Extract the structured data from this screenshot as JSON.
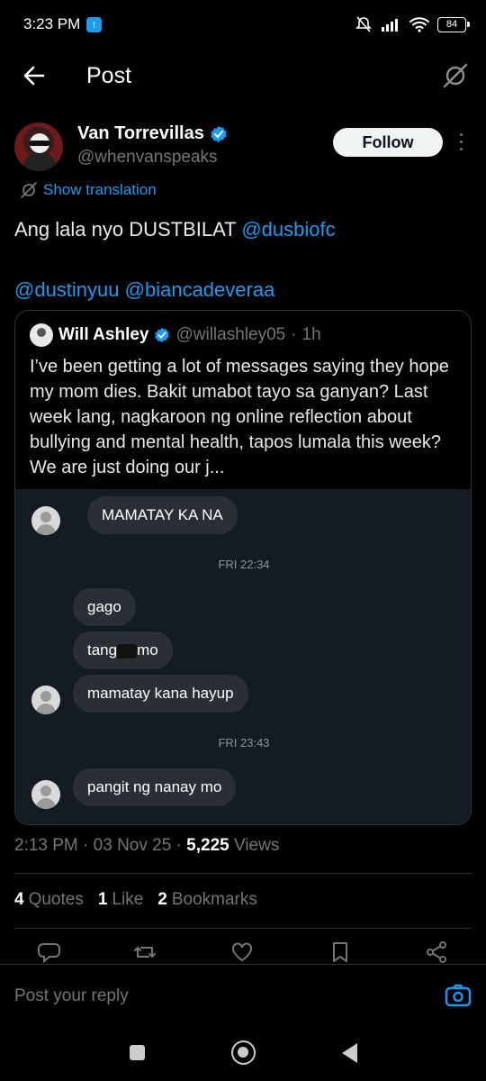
{
  "status_bar": {
    "time": "3:23 PM",
    "battery": "84"
  },
  "nav": {
    "title": "Post"
  },
  "author": {
    "name": "Van Torrevillas",
    "handle": "@whenvanspeaks",
    "follow_label": "Follow"
  },
  "translate_label": "Show translation",
  "tweet": {
    "text": "Ang lala nyo DUSTBILAT",
    "mention1": "@dusbiofc",
    "mention2": "@dustinyuu",
    "mention3": "@biancadeveraa"
  },
  "quote": {
    "name": "Will Ashley",
    "handle": "@willashley05",
    "time": "1h",
    "text": "I’ve been getting a lot of messages saying they hope my mom dies. Bakit umabot tayo sa ganyan? Last week lang, nagkaroon ng online reflection about bullying and mental health, tapos lumala this week? We are just doing our j..."
  },
  "chat": {
    "msg1": "MAMATAY KA NA",
    "time1": "FRI 22:34",
    "msg2": "gago",
    "msg3_a": "tang",
    "msg3_b": "mo",
    "msg4": "mamatay kana hayup",
    "time2": "FRI 23:43",
    "msg5": "pangit ng nanay mo"
  },
  "post_meta": {
    "time": "2:13 PM",
    "date": "03 Nov 25",
    "views_count": "5,225",
    "views_label": "Views"
  },
  "stats": {
    "quotes_count": "4",
    "quotes_label": "Quotes",
    "likes_count": "1",
    "likes_label": "Like",
    "bookmarks_count": "2",
    "bookmarks_label": "Bookmarks"
  },
  "reply": {
    "placeholder": "Post your reply"
  },
  "colors": {
    "accent": "#1d9bf0",
    "background": "#000000",
    "muted": "#71767b"
  },
  "icons": [
    "back-arrow-icon",
    "grok-icon",
    "verified-icon",
    "translate-icon",
    "reply-icon",
    "repost-icon",
    "like-icon",
    "bookmark-icon",
    "share-icon",
    "camera-icon"
  ]
}
